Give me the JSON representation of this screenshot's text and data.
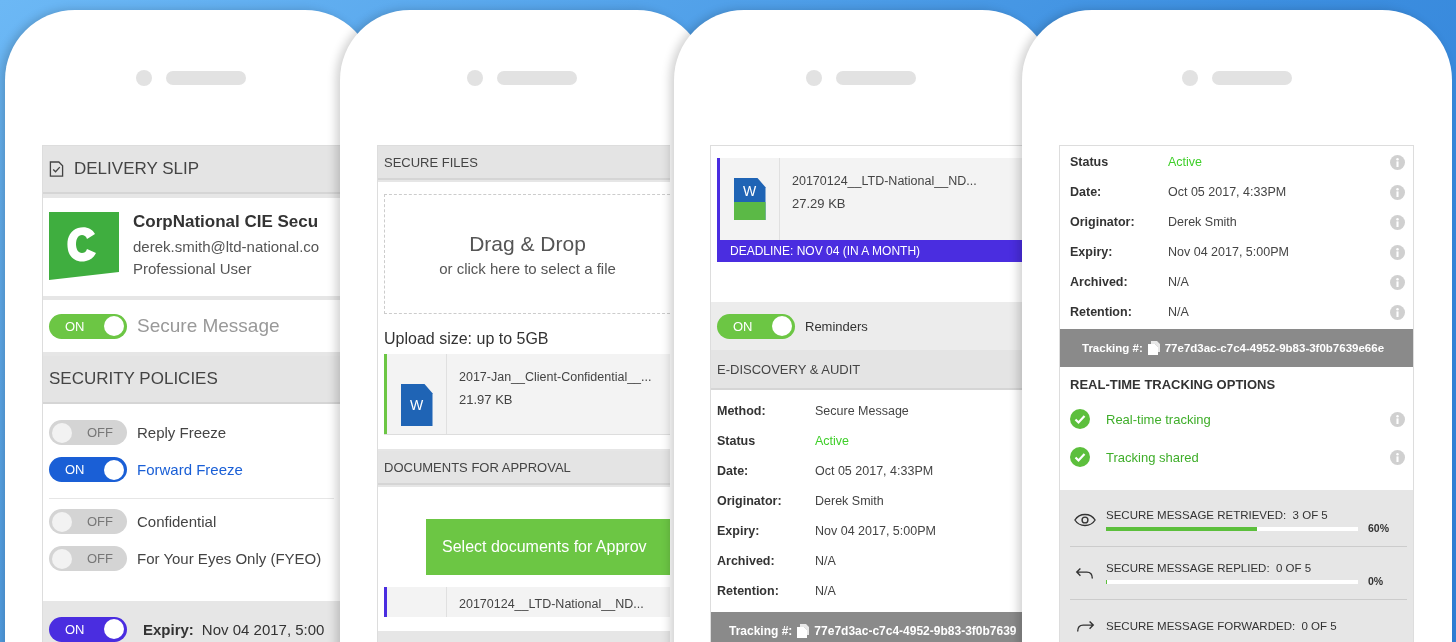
{
  "delivery_phone": {
    "title": "DELIVERY SLIP",
    "account": {
      "name": "CorpNational CIE Secu",
      "email": "derek.smith@ltd-national.co",
      "role": "Professional User"
    },
    "secure_message": {
      "label": "Secure Message",
      "on": true,
      "state_text": "ON",
      "color": "#6cc644"
    },
    "policies_title": "SECURITY POLICIES",
    "policy_groups": [
      [
        {
          "label": "Reply Freeze",
          "on": false,
          "state_text": "OFF"
        },
        {
          "label": "Forward Freeze",
          "on": true,
          "state_text": "ON",
          "color": "#1a5fd6"
        }
      ],
      [
        {
          "label": "Confidential",
          "on": false,
          "state_text": "OFF"
        },
        {
          "label": "For Your Eyes Only (FYEO)",
          "on": false,
          "state_text": "OFF"
        }
      ]
    ],
    "expiry": {
      "label": "Expiry:",
      "value": "Nov 04 2017, 5:00",
      "on": true,
      "state_text": "ON",
      "color": "#4a2de0"
    }
  },
  "files_phone": {
    "title": "SECURE FILES",
    "dropzone": {
      "title": "Drag & Drop",
      "subtitle": "or click here to select a file"
    },
    "upload_note": "Upload size: up to 5GB",
    "file": {
      "name": "2017-Jan__Client-Confidential__...",
      "size": "21.97 KB",
      "icon_letter": "W",
      "color": "#6cc644"
    },
    "approval_title": "DOCUMENTS FOR APPROVAL",
    "approval_button": "Select documents for Approv",
    "approval_file": {
      "name": "20170124__LTD-National__ND...",
      "color": "#4a2de0"
    }
  },
  "audit_phone": {
    "file": {
      "name": "20170124__LTD-National__ND...",
      "size": "27.29 KB",
      "icon_letter": "W",
      "color": "#4a2de0",
      "deadline": "DEADLINE: NOV 04 (IN A MONTH)"
    },
    "reminders": {
      "label": "Reminders",
      "on": true,
      "state_text": "ON",
      "color": "#6cc644"
    },
    "audit_title": "E-DISCOVERY & AUDIT",
    "details": [
      {
        "label": "Method:",
        "value": "Secure Message",
        "kind": "text"
      },
      {
        "label": "Status",
        "value": "Active",
        "kind": "status"
      },
      {
        "label": "Date:",
        "value": "Oct 05 2017, 4:33PM",
        "kind": "text"
      },
      {
        "label": "Originator:",
        "value": "Derek Smith",
        "kind": "text"
      },
      {
        "label": "Expiry:",
        "value": "Nov 04 2017, 5:00PM",
        "kind": "text"
      },
      {
        "label": "Archived:",
        "value": "N/A",
        "kind": "text"
      },
      {
        "label": "Retention:",
        "value": "N/A",
        "kind": "text"
      }
    ],
    "tracking": {
      "label": "Tracking #:",
      "value": "77e7d3ac-c7c4-4952-9b83-3f0b7639"
    }
  },
  "tracking_phone": {
    "details": [
      {
        "label": "Status",
        "value": "Active",
        "kind": "status"
      },
      {
        "label": "Date:",
        "value": "Oct 05 2017, 4:33PM",
        "kind": "text"
      },
      {
        "label": "Originator:",
        "value": "Derek Smith",
        "kind": "text"
      },
      {
        "label": "Expiry:",
        "value": "Nov 04 2017, 5:00PM",
        "kind": "text"
      },
      {
        "label": "Archived:",
        "value": "N/A",
        "kind": "text"
      },
      {
        "label": "Retention:",
        "value": "N/A",
        "kind": "text"
      }
    ],
    "tracking": {
      "label": "Tracking #:",
      "value": "77e7d3ac-c7c4-4952-9b83-3f0b7639e66e"
    },
    "options_title": "REAL-TIME TRACKING OPTIONS",
    "options": [
      {
        "label": "Real-time tracking",
        "checked": true
      },
      {
        "label": "Tracking shared",
        "checked": true
      }
    ],
    "progress": [
      {
        "kind": "eye",
        "label": "SECURE MESSAGE RETRIEVED:",
        "count": "3 OF 5",
        "level": 0.6,
        "reading": "60%"
      },
      {
        "kind": "reply",
        "label": "SECURE MESSAGE REPLIED:",
        "count": "0 OF 5",
        "level": 0,
        "reading": "0%"
      },
      {
        "kind": "forward",
        "label": "SECURE MESSAGE FORWARDED:",
        "count": "0 OF 5"
      }
    ]
  }
}
